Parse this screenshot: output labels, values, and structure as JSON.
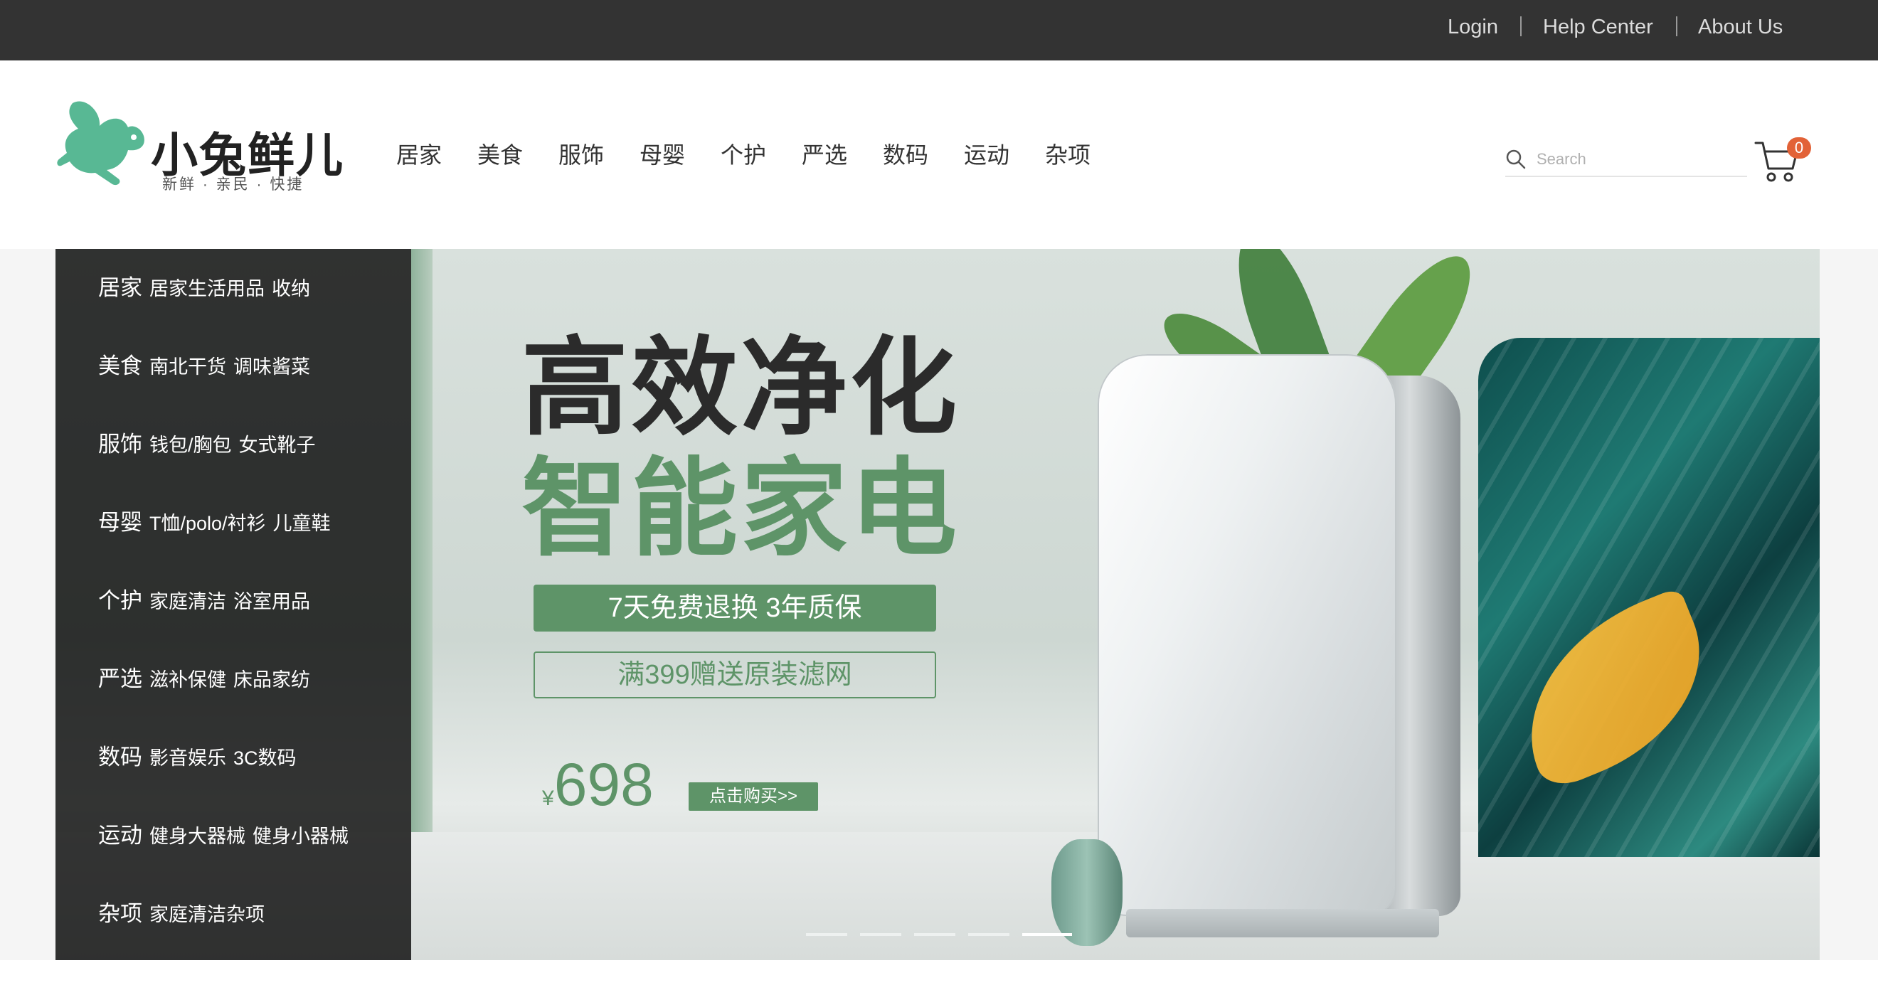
{
  "topbar": {
    "links": [
      "Login",
      "Help Center",
      "About Us"
    ]
  },
  "logo": {
    "title": "小兔鲜儿",
    "tagline": "新鲜 · 亲民 · 快捷"
  },
  "nav": {
    "items": [
      "居家",
      "美食",
      "服饰",
      "母婴",
      "个护",
      "严选",
      "数码",
      "运动",
      "杂项"
    ]
  },
  "search": {
    "placeholder": "Search",
    "icon": "search-icon"
  },
  "cart": {
    "icon": "cart-icon",
    "count": "0",
    "badge_color": "#e26237"
  },
  "categories": [
    {
      "name": "居家",
      "subs": [
        "居家生活用品",
        "收纳"
      ]
    },
    {
      "name": "美食",
      "subs": [
        "南北干货",
        "调味酱菜"
      ]
    },
    {
      "name": "服饰",
      "subs": [
        "钱包/胸包",
        "女式靴子"
      ]
    },
    {
      "name": "母婴",
      "subs": [
        "T恤/polo/衬衫",
        "儿童鞋"
      ]
    },
    {
      "name": "个护",
      "subs": [
        "家庭清洁",
        "浴室用品"
      ]
    },
    {
      "name": "严选",
      "subs": [
        "滋补保健",
        "床品家纺"
      ]
    },
    {
      "name": "数码",
      "subs": [
        "影音娱乐",
        "3C数码"
      ]
    },
    {
      "name": "运动",
      "subs": [
        "健身大器械",
        "健身小器械"
      ]
    },
    {
      "name": "杂项",
      "subs": [
        "家庭清洁杂项"
      ]
    }
  ],
  "banner": {
    "headline_1": "高效净化",
    "headline_2": "智能家电",
    "promo_1": "7天免费退换 3年质保",
    "promo_2": "满399赠送原装滤网",
    "price_symbol": "¥",
    "price": "698",
    "buy_label": "点击购买>>",
    "slide_count": 5,
    "active_slide": 5,
    "accent_color": "#5e9468"
  },
  "colors": {
    "topbar_bg": "#333333",
    "sidebar_bg": "rgba(0,0,0,0.78)"
  }
}
